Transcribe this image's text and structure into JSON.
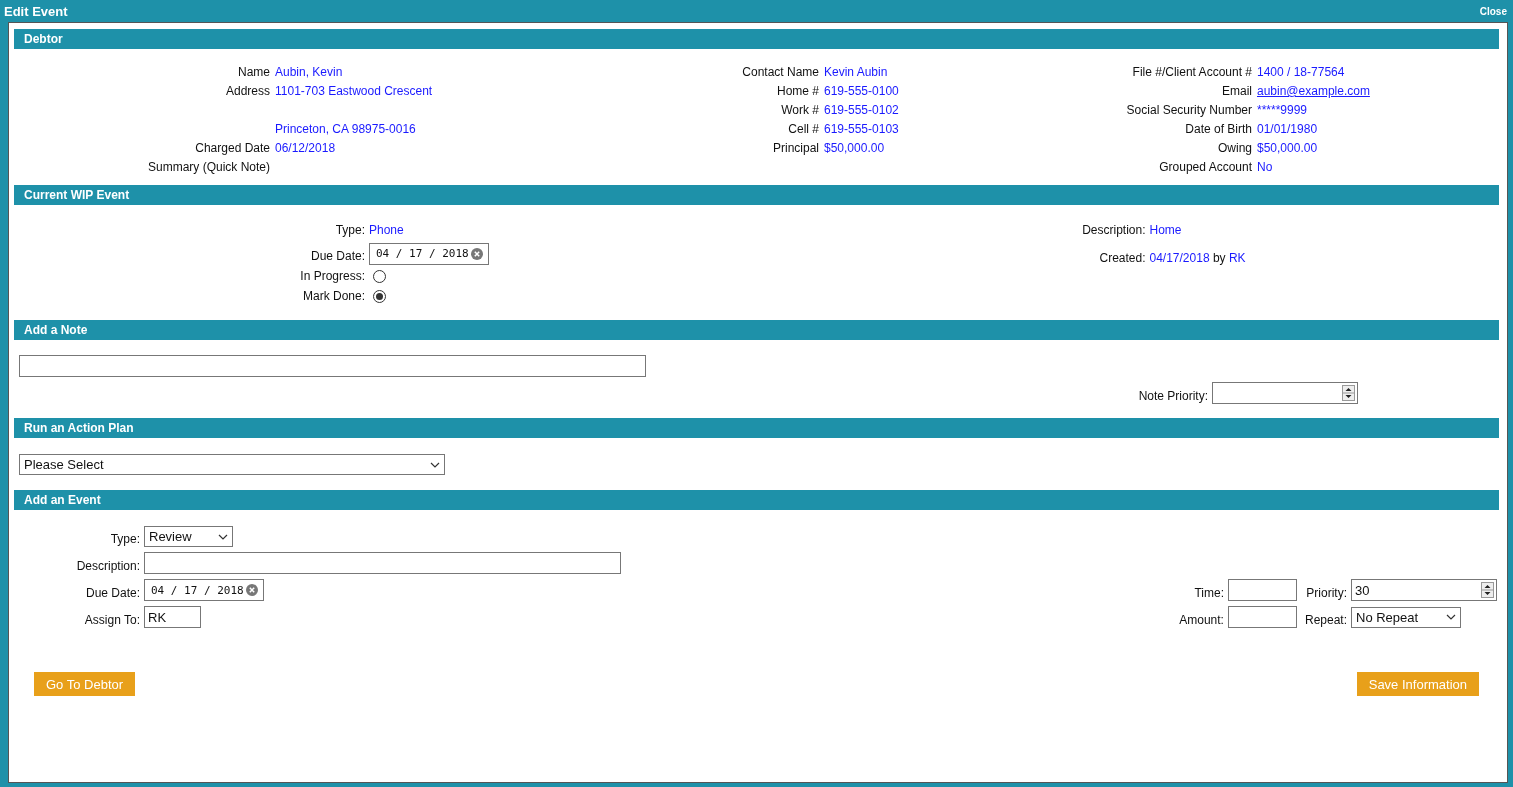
{
  "window": {
    "title": "Edit Event",
    "close": "Close"
  },
  "debtor": {
    "title": "Debtor",
    "columns": [
      [
        {
          "kind": "text",
          "label": "Name",
          "value": "Aubin, Kevin"
        },
        {
          "kind": "address",
          "label": "Address",
          "lines": [
            "1101-703 Eastwood Crescent",
            "Princeton, CA 98975-0016"
          ]
        },
        {
          "kind": "text",
          "label": "Charged Date",
          "value": "06/12/2018"
        },
        {
          "kind": "label",
          "label": "Summary (Quick Note)"
        }
      ],
      [
        {
          "kind": "text",
          "label": "Contact Name",
          "value": "Kevin Aubin"
        },
        {
          "kind": "text",
          "label": "Home #",
          "value": "619-555-0100"
        },
        {
          "kind": "text",
          "label": "Work #",
          "value": "619-555-0102"
        },
        {
          "kind": "text",
          "label": "Cell #",
          "value": "619-555-0103"
        },
        {
          "kind": "text",
          "label": "Principal",
          "value": "$50,000.00"
        }
      ],
      [
        {
          "kind": "text",
          "label": "File #/Client Account #",
          "value": "1400 / 18-77564"
        },
        {
          "kind": "link",
          "label": "Email",
          "value": "aubin@example.com"
        },
        {
          "kind": "text",
          "label": "Social Security Number",
          "value": "*****9999"
        },
        {
          "kind": "text",
          "label": "Date of Birth",
          "value": "01/01/1980"
        },
        {
          "kind": "text",
          "label": "Owing",
          "value": "$50,000.00"
        },
        {
          "kind": "text",
          "label": "Grouped Account",
          "value": "No"
        }
      ]
    ]
  },
  "current_event": {
    "title": "Current WIP Event",
    "type": {
      "label": "Type:",
      "value": "Phone"
    },
    "due_date": {
      "label": "Due Date:",
      "value": "04 / 17 / 2018"
    },
    "statuses": [
      {
        "label": "In Progress:",
        "selected": false
      },
      {
        "label": "Mark Done:",
        "selected": true
      }
    ],
    "description": {
      "label": "Description:",
      "value": "Home"
    },
    "created": {
      "label": "Created:",
      "value": "04/17/2018",
      "joiner": "by",
      "user": "RK"
    }
  },
  "note": {
    "title": "Add a Note",
    "priority_label": "Note Priority:"
  },
  "action_plan": {
    "title": "Run an Action Plan",
    "value": "Please Select"
  },
  "add_event": {
    "title": "Add an Event",
    "left_fields": [
      {
        "kind": "select",
        "label": "Type:",
        "value": "Review"
      },
      {
        "kind": "text",
        "label": "Description:"
      },
      {
        "kind": "date",
        "label": "Due Date:",
        "value": "04 / 17 / 2018"
      },
      {
        "kind": "text",
        "label": "Assign To:",
        "value": "RK"
      }
    ],
    "right_fields": [
      {
        "kind": "text",
        "label": "Time:"
      },
      {
        "kind": "spinner",
        "label": "Priority:",
        "value": "30"
      },
      {
        "kind": "text",
        "label": "Amount:"
      },
      {
        "kind": "select",
        "label": "Repeat:",
        "value": "No Repeat"
      }
    ]
  },
  "buttons": [
    {
      "label": "Go To Debtor"
    },
    {
      "label": "Save Information"
    }
  ]
}
